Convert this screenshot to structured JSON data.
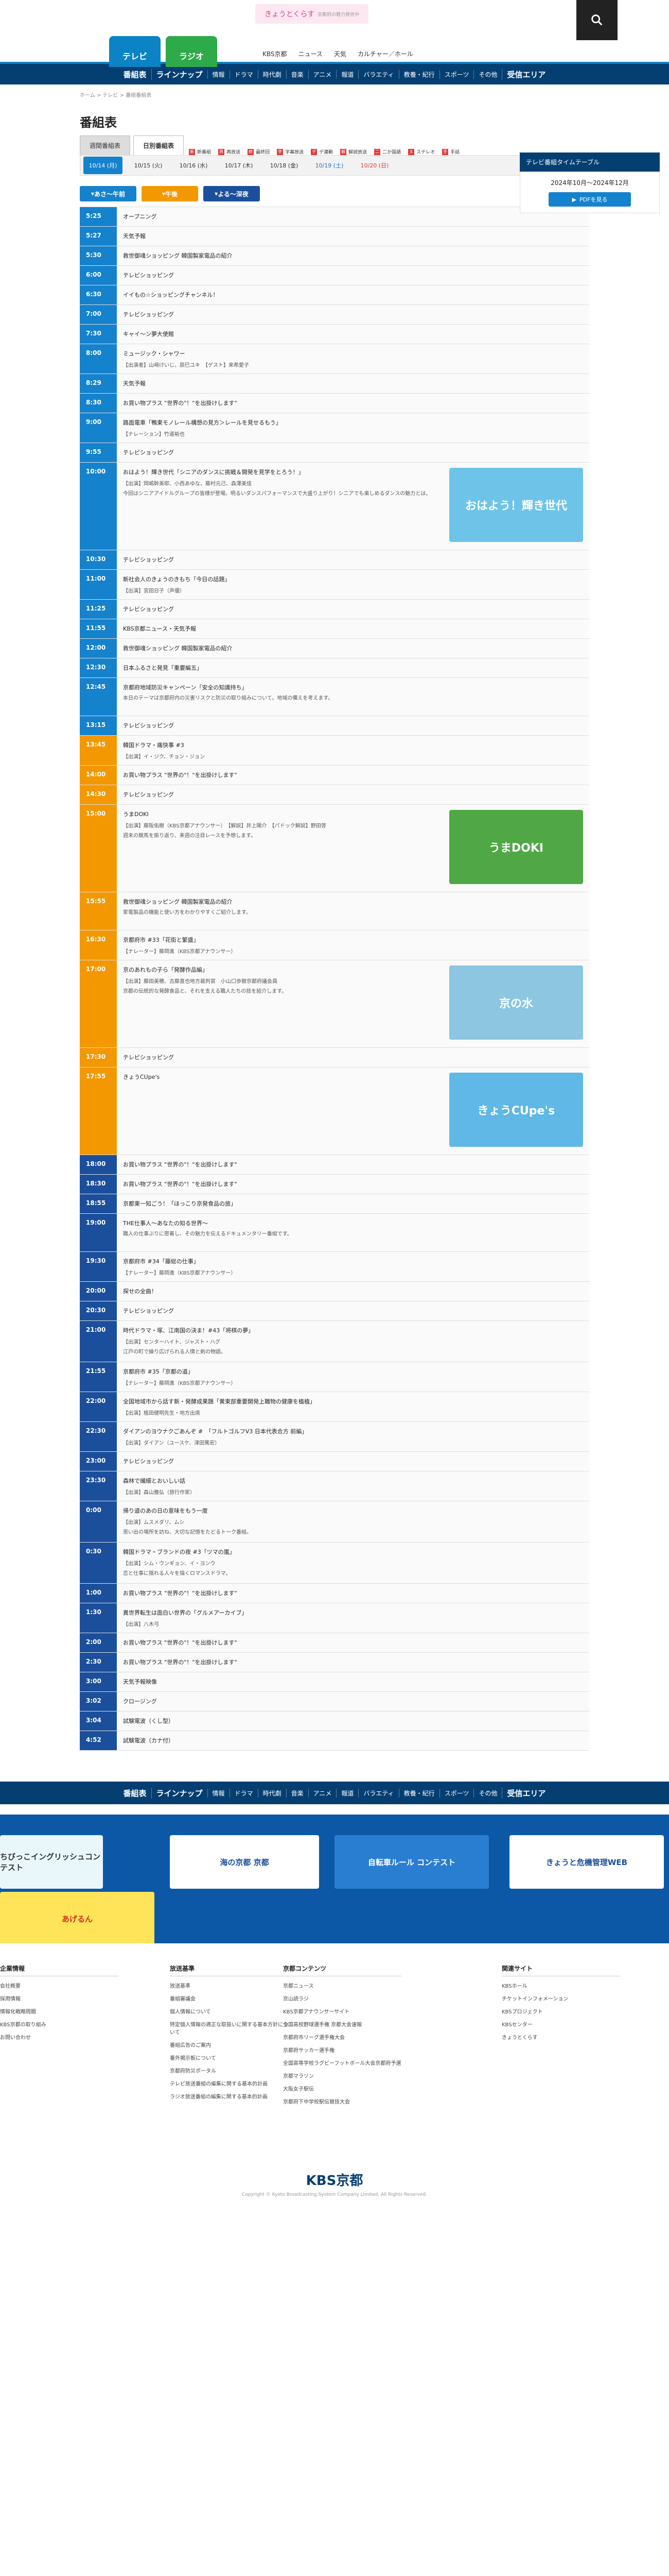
{
  "header": {
    "logo_text": "きょうとくらす",
    "logo_sub": "京都府の魅力発信中",
    "tab_tv": "テレビ",
    "tab_radio": "ラジオ",
    "links": [
      "KBS京都",
      "ニュース",
      "天気",
      "カルチャー／ホール"
    ]
  },
  "gnav": [
    "番組表",
    "ラインナップ",
    "情報",
    "ドラマ",
    "時代劇",
    "音楽",
    "アニメ",
    "報道",
    "バラエティ",
    "教養・紀行",
    "スポーツ",
    "その他",
    "受信エリア"
  ],
  "breadcrumb": "ホーム > テレビ > 番組番組表",
  "page_title": "番組表",
  "subtabs": [
    "週間番組表",
    "日別番組表"
  ],
  "legend": [
    {
      "mark": "新",
      "label": "新番組"
    },
    {
      "mark": "再",
      "label": "再放送"
    },
    {
      "mark": "終",
      "label": "最終回"
    },
    {
      "mark": "字",
      "label": "字幕放送"
    },
    {
      "mark": "デ",
      "label": "デ連動"
    },
    {
      "mark": "解",
      "label": "解説放送"
    },
    {
      "mark": "二",
      "label": "二か国語"
    },
    {
      "mark": "S",
      "label": "ステレオ"
    },
    {
      "mark": "手",
      "label": "手話"
    }
  ],
  "dates": [
    {
      "label": "10/14 (月)",
      "state": "on"
    },
    {
      "label": "10/15 (火)",
      "state": ""
    },
    {
      "label": "10/16 (水)",
      "state": ""
    },
    {
      "label": "10/17 (木)",
      "state": ""
    },
    {
      "label": "10/18 (金)",
      "state": ""
    },
    {
      "label": "10/19 (土)",
      "state": "sat"
    },
    {
      "label": "10/20 (日)",
      "state": "sun"
    }
  ],
  "periods": [
    {
      "label": "あさ～午前",
      "color": "#1582cd"
    },
    {
      "label": "午後",
      "color": "#f39800"
    },
    {
      "label": "よる～深夜",
      "color": "#1b4f9c"
    }
  ],
  "colors": {
    "morning": "#1582cd",
    "afternoon": "#f39800",
    "night": "#1b4f9c",
    "navy": "#053f72"
  },
  "sidebar": {
    "head": "テレビ番組タイムテーブル",
    "period": "2024年10月～2024年12月",
    "pdf": "PDFを見る"
  },
  "programs": [
    {
      "time": "5:25",
      "band": "morning",
      "title": "オープニング"
    },
    {
      "time": "5:27",
      "band": "morning",
      "title": "天気予報"
    },
    {
      "time": "5:30",
      "band": "morning",
      "title": "救世御魂ショッピング 韓国製家電品の紹介"
    },
    {
      "time": "6:00",
      "band": "morning",
      "title": "テレビショッピング"
    },
    {
      "time": "6:30",
      "band": "morning",
      "title": "イイもの☆ショッピングチャンネル！"
    },
    {
      "time": "7:00",
      "band": "morning",
      "title": "テレビショッピング"
    },
    {
      "time": "7:30",
      "band": "morning",
      "title": "キャイ〜ン夢大使館"
    },
    {
      "time": "8:00",
      "band": "morning",
      "title": "ミュージック・シャワー",
      "cast": "【出演者】山﨑けいじ、辰巳ユキ　【ゲスト】来希愛子"
    },
    {
      "time": "8:29",
      "band": "morning",
      "title": "天気予報"
    },
    {
      "time": "8:30",
      "band": "morning",
      "title": "お買い物プラス \"世界の\"！\"を出掛けします\""
    },
    {
      "time": "9:00",
      "band": "morning",
      "title": "路面電車「鴨東モノレール構想の見方＞レールを見せるもう」",
      "cast": "【ナレーション】竹道裕也"
    },
    {
      "time": "9:55",
      "band": "morning",
      "title": "テレビショッピング"
    },
    {
      "time": "10:00",
      "band": "morning",
      "title": "おはよう！輝き世代「シニアのダンスに挑戦＆開発を見学をとろう！」",
      "cast": "【出演】岡嶋幹美耶、小西あゆな、藤村元己、森澤美佳",
      "desc": "今回はシニアアイドルグループの皆様が登場。明るいダンスパフォーマンスで大盛り上がり！シニアでも楽しめるダンスの魅力とは。",
      "thumb": "おはよう！輝き世代",
      "thumbColor": "#6ec4e8"
    },
    {
      "time": "10:30",
      "band": "morning",
      "title": "テレビショッピング"
    },
    {
      "time": "11:00",
      "band": "morning",
      "title": "新社会人のきょうのきもち「今日の話題」",
      "cast": "【出演】宮田日子（声優）"
    },
    {
      "time": "11:25",
      "band": "morning",
      "title": "テレビショッピング"
    },
    {
      "time": "11:55",
      "band": "morning",
      "title": "KBS京都ニュース・天気予報"
    },
    {
      "time": "12:00",
      "band": "morning",
      "title": "救世御魂ショッピング 韓国製家電品の紹介"
    },
    {
      "time": "12:30",
      "band": "morning",
      "title": "日本ふるさと発見「重要編五」"
    },
    {
      "time": "12:45",
      "band": "morning",
      "title": "京都府地域防災キャンペーン「安全の知識持ち」",
      "desc": "本日のテーマは京都府内の災害リスクと防災の取り組みについて。地域の備えを考えます。"
    },
    {
      "time": "13:15",
      "band": "morning",
      "title": "テレビショッピング"
    },
    {
      "time": "13:45",
      "band": "afternoon",
      "title": "韓国ドラマ・痛快事 #3",
      "cast": "【出演】イ・ジク、チョン・ジョン"
    },
    {
      "time": "14:00",
      "band": "afternoon",
      "title": "お買い物プラス \"世界の\"！\"を出掛けします\""
    },
    {
      "time": "14:30",
      "band": "afternoon",
      "title": "テレビショッピング"
    },
    {
      "time": "15:00",
      "band": "afternoon",
      "title": "うまDOKI",
      "cast": "【出演】藤阪佑樹（KBS京都アナウンサー）　【解説】井上陽介　【パドック解説】野田啓",
      "desc": "週末の競馬を振り返り、来週の注目レースを予想します。",
      "thumb": "うまDOKI",
      "thumbColor": "#4fa845"
    },
    {
      "time": "15:55",
      "band": "afternoon",
      "title": "救世御魂ショッピング 韓国製家電品の紹介",
      "desc": "家電製品の機能と使い方をわかりやすくご紹介します。"
    },
    {
      "time": "16:30",
      "band": "afternoon",
      "title": "京都府市 #33「花街と繁盛」",
      "cast": "【ナレーター】藤岡進（KBS京都アナウンサー）"
    },
    {
      "time": "17:00",
      "band": "afternoon",
      "title": "京のあれもの子ら「発酵作品編」",
      "cast": "【出演】藤田美穂、古藤直也地方裁判官　小山口歩樹京都府議会員",
      "desc": "京都の伝統的な発酵食品と、それを支える職人たちの技を紹介します。",
      "thumb": "京の水",
      "thumbColor": "#8cc6e0"
    },
    {
      "time": "17:30",
      "band": "afternoon",
      "title": "テレビショッピング"
    },
    {
      "time": "17:55",
      "band": "afternoon",
      "title": "きょうCUpe's",
      "thumb": "きょうCUpe's",
      "thumbColor": "#5fb8e5"
    },
    {
      "time": "18:00",
      "band": "night",
      "title": "お買い物プラス \"世界の\"！\"を出掛けします\""
    },
    {
      "time": "18:30",
      "band": "night",
      "title": "お買い物プラス \"世界の\"！\"を出掛けします\""
    },
    {
      "time": "18:55",
      "band": "night",
      "title": "京都東一知ごう！「ほっこり京発食品の旅」"
    },
    {
      "time": "19:00",
      "band": "night",
      "title": "THE仕事人～あなたの知る世界～",
      "desc": "職人の仕事ぶりに密着し、その魅力を伝えるドキュメンタリー番組です。"
    },
    {
      "time": "19:30",
      "band": "night",
      "title": "京都府市 #34「藤総の仕事」",
      "cast": "【ナレーター】藤岡進（KBS京都アナウンサー）"
    },
    {
      "time": "20:00",
      "band": "night",
      "title": "探せの全曲！"
    },
    {
      "time": "20:30",
      "band": "night",
      "title": "テレビショッピング"
    },
    {
      "time": "21:00",
      "band": "night",
      "title": "時代ドラマ・塚、江南国の決ま！#43「将棋の夢」",
      "cast": "【出演】センターハイト、ジャスト・ハグ",
      "desc": "江戸の町で繰り広げられる人情と剣の物語。"
    },
    {
      "time": "21:55",
      "band": "night",
      "title": "京都府市 #35「京都の道」",
      "cast": "【ナレーター】藤岡進（KBS京都アナウンサー）"
    },
    {
      "time": "22:00",
      "band": "night",
      "title": "全国地域市から話す新・発酵成果題「黄東部重要開発上職物の健康を植植」",
      "cast": "【出演】植田健明先生・地方出席"
    },
    {
      "time": "22:30",
      "band": "night",
      "title": "ダイアンのヨウナクごあんぞ #　「フルトゴルフV3 日本代表合方 前編」",
      "cast": "【出演】ダイアン（ユースケ、津田篤宏）"
    },
    {
      "time": "23:00",
      "band": "night",
      "title": "テレビショッピング"
    },
    {
      "time": "23:30",
      "band": "night",
      "title": "森林で繊細とおいしい話",
      "cast": "【出演】森山雅弘（旅行作家）"
    },
    {
      "time": "0:00",
      "band": "night",
      "title": "帰り道のあの日の意味をもう一度",
      "cast": "【出演】ムスメダリ、ムシ",
      "desc": "思い出の場所を訪ね、大切な記憶をたどるトーク番組。"
    },
    {
      "time": "0:30",
      "band": "night",
      "title": "韓国ドラマ・ブランドの夜 #3「ツマの嵐」",
      "cast": "【出演】シム・ウンギョン、イ・ヨンウ",
      "desc": "恋と仕事に揺れる人々を描くロマンスドラマ。"
    },
    {
      "time": "1:00",
      "band": "night",
      "title": "お買い物プラス \"世界の\"！\"を出掛けします\""
    },
    {
      "time": "1:30",
      "band": "night",
      "title": "異世界転生は面白い世界の「グルメアーカイブ」",
      "cast": "【出演】八木弓"
    },
    {
      "time": "2:00",
      "band": "night",
      "title": "お買い物プラス \"世界の\"！\"を出掛けします\""
    },
    {
      "time": "2:30",
      "band": "night",
      "title": "お買い物プラス \"世界の\"！\"を出掛けします\""
    },
    {
      "time": "3:00",
      "band": "night",
      "title": "天気予報映像"
    },
    {
      "time": "3:02",
      "band": "night",
      "title": "クロージング"
    },
    {
      "time": "3:04",
      "band": "night",
      "title": "試験電波（くし型）"
    },
    {
      "time": "4:52",
      "band": "night",
      "title": "試験電波（カナ付）"
    }
  ],
  "banners": [
    {
      "label": "ちびっこイングリッシュコンテスト",
      "color": "#e9f7fb",
      "text": "#333"
    },
    {
      "label": "海の京都 京都",
      "color": "#ffffff",
      "text": "#1b4f9c"
    },
    {
      "label": "自転車ルール コンテスト",
      "color": "#2a7ed1",
      "text": "#fff"
    },
    {
      "label": "きょうと危機管理WEB",
      "color": "#ffffff",
      "text": "#1b4f9c"
    },
    {
      "label": "あげるん",
      "color": "#ffe45a",
      "text": "#d4321b"
    }
  ],
  "footer": {
    "columns": [
      {
        "head": "企業情報",
        "items": [
          "会社概要",
          "採用情報",
          "情報化戦略問題",
          "KBS京都の取り組み",
          "お問い合わせ"
        ]
      },
      {
        "head": "放送基準",
        "items": [
          "放送基準",
          "番組審議会",
          "個人情報について",
          "特定個人情報の適正な取扱いに関する基本方針について",
          "番組広告のご案内",
          "番外掲示板について",
          "京都府防災ポータル",
          "テレビ放送番組の編集に関する基本的計画",
          "ラジオ放送番組の編集に関する基本的計画"
        ]
      },
      {
        "head": "京都コンテンツ",
        "items": [
          "京都ニュース",
          "京山読ラジ",
          "KBS京都アナウンサーサイト",
          "全国高校野球選手権 京都大会速報",
          "京都府市リーグ選手権大会",
          "京都府サッカー選手権",
          "全国高等学校ラグビーフットボール大会京都府予選",
          "京都マラソン",
          "大阪女子駅伝",
          "京都府下中学校駅伝競技大会"
        ]
      },
      {
        "head": "関連サイト",
        "items": [
          "KBSホール",
          "チケットインフォメーション",
          "KBSプロジェクト",
          "KBSセンター",
          "きょうとくらす"
        ]
      }
    ],
    "logo": "KBS京都",
    "copyright": "Copyright © Kyoto Broadcasting System Company Limited. All Rights Reserved."
  }
}
